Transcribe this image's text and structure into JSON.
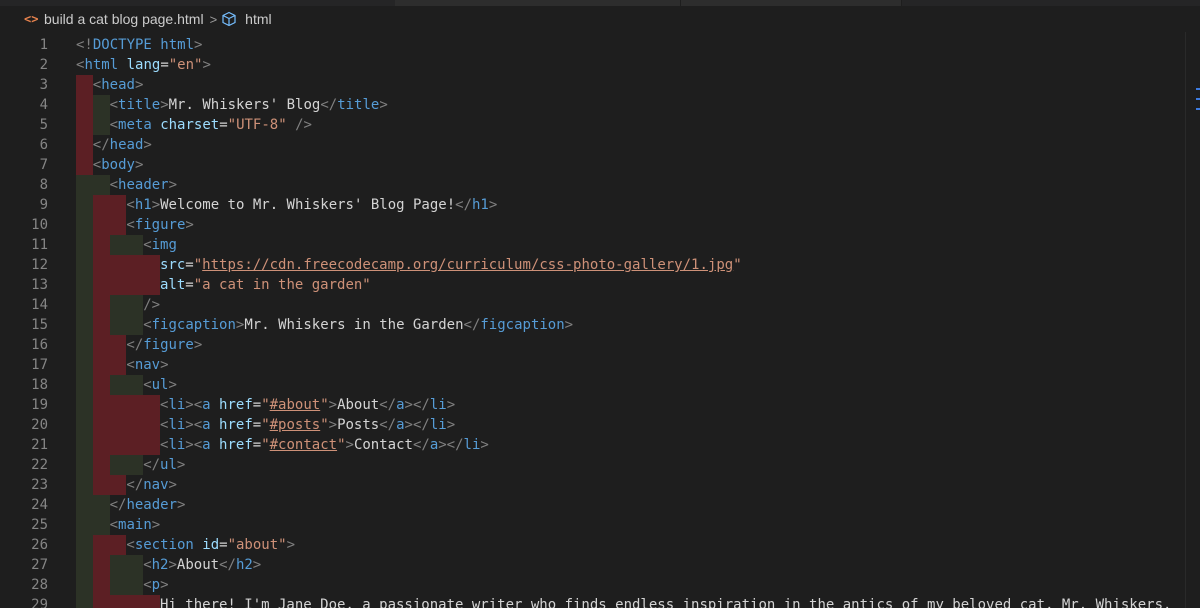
{
  "breadcrumb": {
    "file_icon": "code-file-icon",
    "file": "build a cat blog page.html",
    "separator": ">",
    "symbol_icon": "symbol-cube-icon",
    "symbol": "html"
  },
  "colors": {
    "background": "#1e1e1e",
    "line_number": "#858585",
    "tag_bracket": "#808080",
    "tag_name": "#569cd6",
    "attribute": "#9cdcfe",
    "string": "#ce9178",
    "text": "#d4d4d4",
    "indent_red": "#5c1f24",
    "indent_green": "#2c3226"
  },
  "lines": [
    {
      "n": "1",
      "indent": [],
      "tokens": [
        [
          "tag",
          "<!"
        ],
        [
          "name",
          "DOCTYPE html"
        ],
        [
          "tag",
          ">"
        ]
      ]
    },
    {
      "n": "2",
      "indent": [],
      "tokens": [
        [
          "tag",
          "<"
        ],
        [
          "name",
          "html"
        ],
        [
          "text",
          " "
        ],
        [
          "attr",
          "lang"
        ],
        [
          "text",
          "="
        ],
        [
          "str",
          "\"en\""
        ],
        [
          "tag",
          ">"
        ]
      ]
    },
    {
      "n": "3",
      "indent": [
        "red"
      ],
      "tokens": [
        [
          "tag",
          "<"
        ],
        [
          "name",
          "head"
        ],
        [
          "tag",
          ">"
        ]
      ]
    },
    {
      "n": "4",
      "indent": [
        "red",
        "green"
      ],
      "tokens": [
        [
          "tag",
          "<"
        ],
        [
          "name",
          "title"
        ],
        [
          "tag",
          ">"
        ],
        [
          "text",
          "Mr. Whiskers' Blog"
        ],
        [
          "tag",
          "</"
        ],
        [
          "name",
          "title"
        ],
        [
          "tag",
          ">"
        ]
      ]
    },
    {
      "n": "5",
      "indent": [
        "red",
        "green"
      ],
      "tokens": [
        [
          "tag",
          "<"
        ],
        [
          "name",
          "meta"
        ],
        [
          "text",
          " "
        ],
        [
          "attr",
          "charset"
        ],
        [
          "text",
          "="
        ],
        [
          "str",
          "\"UTF-8\""
        ],
        [
          "text",
          " "
        ],
        [
          "tag",
          "/>"
        ]
      ]
    },
    {
      "n": "6",
      "indent": [
        "red"
      ],
      "tokens": [
        [
          "tag",
          "</"
        ],
        [
          "name",
          "head"
        ],
        [
          "tag",
          ">"
        ]
      ]
    },
    {
      "n": "7",
      "indent": [
        "red"
      ],
      "tokens": [
        [
          "tag",
          "<"
        ],
        [
          "name",
          "body"
        ],
        [
          "tag",
          ">"
        ]
      ]
    },
    {
      "n": "8",
      "indent": [
        "green",
        "green"
      ],
      "tokens": [
        [
          "tag",
          "<"
        ],
        [
          "name",
          "header"
        ],
        [
          "tag",
          ">"
        ]
      ]
    },
    {
      "n": "9",
      "indent": [
        "green",
        "red",
        "red"
      ],
      "tokens": [
        [
          "tag",
          "<"
        ],
        [
          "name",
          "h1"
        ],
        [
          "tag",
          ">"
        ],
        [
          "text",
          "Welcome to Mr. Whiskers' Blog Page!"
        ],
        [
          "tag",
          "</"
        ],
        [
          "name",
          "h1"
        ],
        [
          "tag",
          ">"
        ]
      ]
    },
    {
      "n": "10",
      "indent": [
        "green",
        "red",
        "red"
      ],
      "tokens": [
        [
          "tag",
          "<"
        ],
        [
          "name",
          "figure"
        ],
        [
          "tag",
          ">"
        ]
      ]
    },
    {
      "n": "11",
      "indent": [
        "green",
        "red",
        "green",
        "green"
      ],
      "tokens": [
        [
          "tag",
          "<"
        ],
        [
          "name",
          "img"
        ]
      ]
    },
    {
      "n": "12",
      "indent": [
        "green",
        "red",
        "red",
        "red",
        "red"
      ],
      "tokens": [
        [
          "attr",
          "src"
        ],
        [
          "text",
          "="
        ],
        [
          "str",
          "\""
        ],
        [
          "url",
          "https://cdn.freecodecamp.org/curriculum/css-photo-gallery/1.jpg"
        ],
        [
          "str",
          "\""
        ]
      ]
    },
    {
      "n": "13",
      "indent": [
        "green",
        "red",
        "red",
        "red",
        "red"
      ],
      "tokens": [
        [
          "attr",
          "alt"
        ],
        [
          "text",
          "="
        ],
        [
          "str",
          "\"a cat in the garden\""
        ]
      ]
    },
    {
      "n": "14",
      "indent": [
        "green",
        "red",
        "green",
        "green"
      ],
      "tokens": [
        [
          "tag",
          "/>"
        ]
      ]
    },
    {
      "n": "15",
      "indent": [
        "green",
        "red",
        "green",
        "green"
      ],
      "tokens": [
        [
          "tag",
          "<"
        ],
        [
          "name",
          "figcaption"
        ],
        [
          "tag",
          ">"
        ],
        [
          "text",
          "Mr. Whiskers in the Garden"
        ],
        [
          "tag",
          "</"
        ],
        [
          "name",
          "figcaption"
        ],
        [
          "tag",
          ">"
        ]
      ]
    },
    {
      "n": "16",
      "indent": [
        "green",
        "red",
        "red"
      ],
      "tokens": [
        [
          "tag",
          "</"
        ],
        [
          "name",
          "figure"
        ],
        [
          "tag",
          ">"
        ]
      ]
    },
    {
      "n": "17",
      "indent": [
        "green",
        "red",
        "red"
      ],
      "tokens": [
        [
          "tag",
          "<"
        ],
        [
          "name",
          "nav"
        ],
        [
          "tag",
          ">"
        ]
      ]
    },
    {
      "n": "18",
      "indent": [
        "green",
        "red",
        "green",
        "green"
      ],
      "tokens": [
        [
          "tag",
          "<"
        ],
        [
          "name",
          "ul"
        ],
        [
          "tag",
          ">"
        ]
      ]
    },
    {
      "n": "19",
      "indent": [
        "green",
        "red",
        "red",
        "red",
        "red"
      ],
      "tokens": [
        [
          "tag",
          "<"
        ],
        [
          "name",
          "li"
        ],
        [
          "tag",
          "><"
        ],
        [
          "name",
          "a"
        ],
        [
          "text",
          " "
        ],
        [
          "attr",
          "href"
        ],
        [
          "text",
          "="
        ],
        [
          "str",
          "\""
        ],
        [
          "url",
          "#about"
        ],
        [
          "str",
          "\""
        ],
        [
          "tag",
          ">"
        ],
        [
          "text",
          "About"
        ],
        [
          "tag",
          "</"
        ],
        [
          "name",
          "a"
        ],
        [
          "tag",
          "></"
        ],
        [
          "name",
          "li"
        ],
        [
          "tag",
          ">"
        ]
      ]
    },
    {
      "n": "20",
      "indent": [
        "green",
        "red",
        "red",
        "red",
        "red"
      ],
      "tokens": [
        [
          "tag",
          "<"
        ],
        [
          "name",
          "li"
        ],
        [
          "tag",
          "><"
        ],
        [
          "name",
          "a"
        ],
        [
          "text",
          " "
        ],
        [
          "attr",
          "href"
        ],
        [
          "text",
          "="
        ],
        [
          "str",
          "\""
        ],
        [
          "url",
          "#posts"
        ],
        [
          "str",
          "\""
        ],
        [
          "tag",
          ">"
        ],
        [
          "text",
          "Posts"
        ],
        [
          "tag",
          "</"
        ],
        [
          "name",
          "a"
        ],
        [
          "tag",
          "></"
        ],
        [
          "name",
          "li"
        ],
        [
          "tag",
          ">"
        ]
      ]
    },
    {
      "n": "21",
      "indent": [
        "green",
        "red",
        "red",
        "red",
        "red"
      ],
      "tokens": [
        [
          "tag",
          "<"
        ],
        [
          "name",
          "li"
        ],
        [
          "tag",
          "><"
        ],
        [
          "name",
          "a"
        ],
        [
          "text",
          " "
        ],
        [
          "attr",
          "href"
        ],
        [
          "text",
          "="
        ],
        [
          "str",
          "\""
        ],
        [
          "url",
          "#contact"
        ],
        [
          "str",
          "\""
        ],
        [
          "tag",
          ">"
        ],
        [
          "text",
          "Contact"
        ],
        [
          "tag",
          "</"
        ],
        [
          "name",
          "a"
        ],
        [
          "tag",
          "></"
        ],
        [
          "name",
          "li"
        ],
        [
          "tag",
          ">"
        ]
      ]
    },
    {
      "n": "22",
      "indent": [
        "green",
        "red",
        "green",
        "green"
      ],
      "tokens": [
        [
          "tag",
          "</"
        ],
        [
          "name",
          "ul"
        ],
        [
          "tag",
          ">"
        ]
      ]
    },
    {
      "n": "23",
      "indent": [
        "green",
        "red",
        "red"
      ],
      "tokens": [
        [
          "tag",
          "</"
        ],
        [
          "name",
          "nav"
        ],
        [
          "tag",
          ">"
        ]
      ]
    },
    {
      "n": "24",
      "indent": [
        "green",
        "green"
      ],
      "tokens": [
        [
          "tag",
          "</"
        ],
        [
          "name",
          "header"
        ],
        [
          "tag",
          ">"
        ]
      ]
    },
    {
      "n": "25",
      "indent": [
        "green",
        "green"
      ],
      "tokens": [
        [
          "tag",
          "<"
        ],
        [
          "name",
          "main"
        ],
        [
          "tag",
          ">"
        ]
      ]
    },
    {
      "n": "26",
      "indent": [
        "green",
        "red",
        "red"
      ],
      "tokens": [
        [
          "tag",
          "<"
        ],
        [
          "name",
          "section"
        ],
        [
          "text",
          " "
        ],
        [
          "attr",
          "id"
        ],
        [
          "text",
          "="
        ],
        [
          "str",
          "\"about\""
        ],
        [
          "tag",
          ">"
        ]
      ]
    },
    {
      "n": "27",
      "indent": [
        "green",
        "red",
        "green",
        "green"
      ],
      "tokens": [
        [
          "tag",
          "<"
        ],
        [
          "name",
          "h2"
        ],
        [
          "tag",
          ">"
        ],
        [
          "text",
          "About"
        ],
        [
          "tag",
          "</"
        ],
        [
          "name",
          "h2"
        ],
        [
          "tag",
          ">"
        ]
      ]
    },
    {
      "n": "28",
      "indent": [
        "green",
        "red",
        "green",
        "green"
      ],
      "tokens": [
        [
          "tag",
          "<"
        ],
        [
          "name",
          "p"
        ],
        [
          "tag",
          ">"
        ]
      ]
    },
    {
      "n": "29",
      "indent": [
        "green",
        "red",
        "red",
        "red",
        "red"
      ],
      "tokens": [
        [
          "text",
          "Hi there! I'm Jane Doe, a passionate writer who finds endless inspiration in the antics of my beloved cat, Mr. Whiskers."
        ]
      ]
    }
  ]
}
